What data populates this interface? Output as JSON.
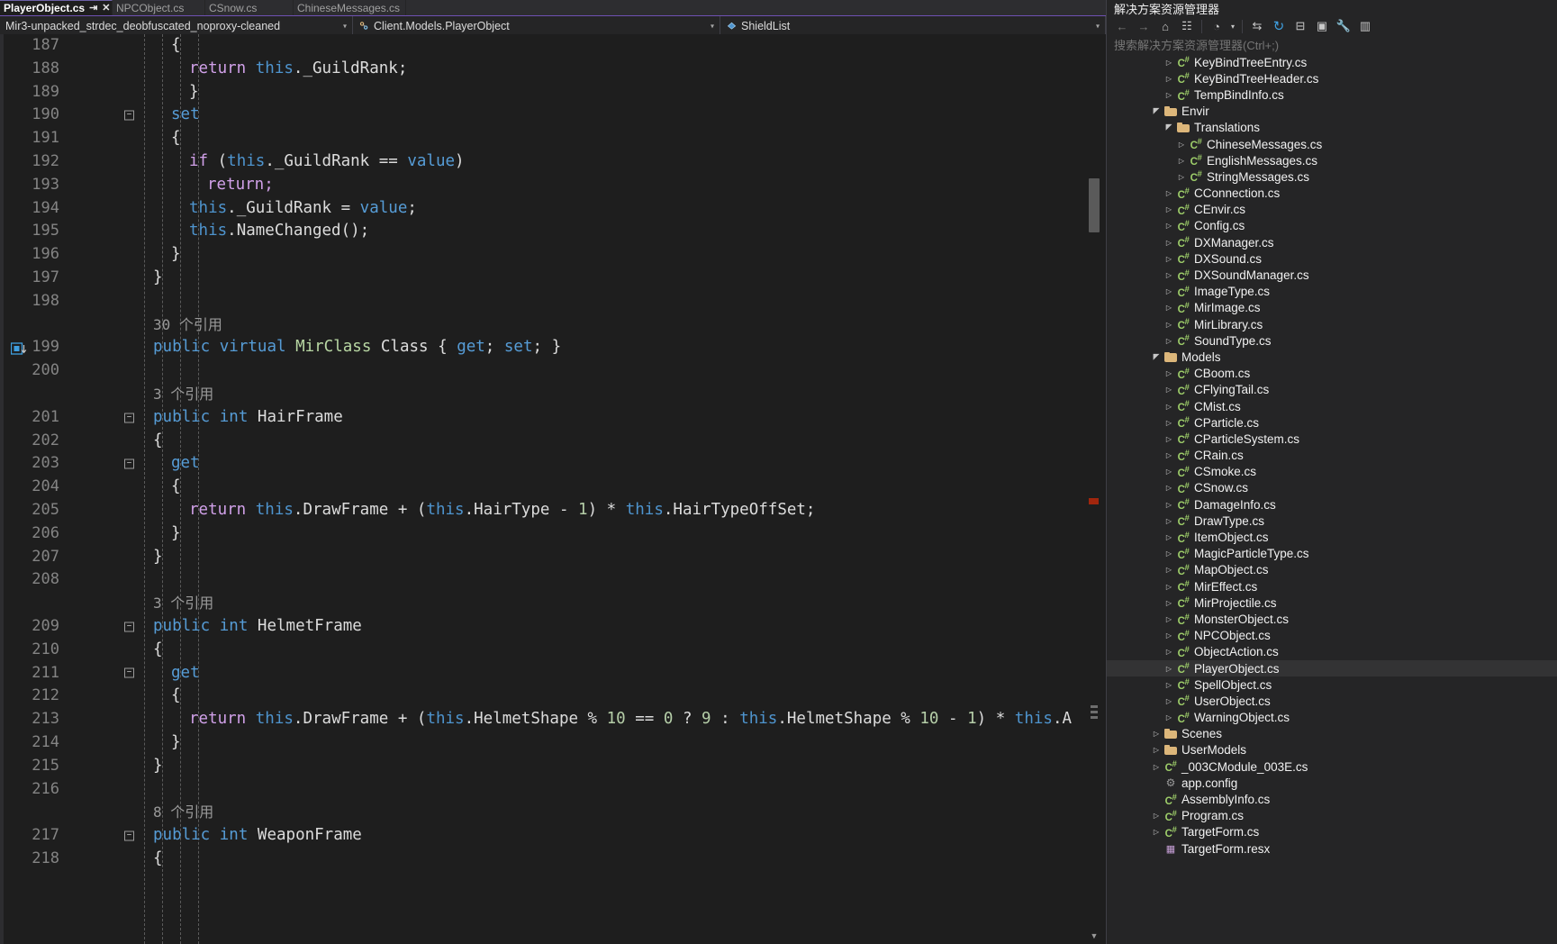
{
  "window": {
    "app": "Visual Studio",
    "theme_bg": "#1e1e1e",
    "accent": "#6f51b3"
  },
  "tabs": [
    {
      "label": "PlayerObject.cs",
      "active": true,
      "pin": "⇥",
      "close": "✕"
    },
    {
      "label": "NPCObject.cs",
      "active": false
    },
    {
      "label": "CSnow.cs",
      "active": false
    },
    {
      "label": "ChineseMessages.cs",
      "active": false
    }
  ],
  "navbar": {
    "project": "Mir3-unpacked_strdec_deobfuscated_noproxy-cleaned",
    "type": "Client.Models.PlayerObject",
    "member": "ShieldList",
    "caret": "▾"
  },
  "editor": {
    "first_line": 187,
    "lines": [
      {
        "num": "187",
        "indent": 4,
        "fold": false,
        "tokens": [
          {
            "t": "{",
            "c": "p"
          }
        ]
      },
      {
        "num": "188",
        "indent": 5,
        "fold": false,
        "tokens": [
          {
            "t": "return ",
            "c": "kc"
          },
          {
            "t": "this",
            "c": "th"
          },
          {
            "t": "._GuildRank;",
            "c": "p"
          }
        ]
      },
      {
        "num": "189",
        "indent": 5,
        "fold": false,
        "tokens": [
          {
            "t": "}",
            "c": "p"
          }
        ]
      },
      {
        "num": "190",
        "indent": 4,
        "fold": true,
        "tokens": [
          {
            "t": "set",
            "c": "k"
          }
        ]
      },
      {
        "num": "191",
        "indent": 4,
        "fold": false,
        "tokens": [
          {
            "t": "{",
            "c": "p"
          }
        ]
      },
      {
        "num": "192",
        "indent": 5,
        "fold": false,
        "tokens": [
          {
            "t": "if ",
            "c": "kc"
          },
          {
            "t": "(",
            "c": "p"
          },
          {
            "t": "this",
            "c": "th"
          },
          {
            "t": "._GuildRank == ",
            "c": "p"
          },
          {
            "t": "value",
            "c": "k"
          },
          {
            "t": ")",
            "c": "p"
          }
        ]
      },
      {
        "num": "193",
        "indent": 6,
        "fold": false,
        "tokens": [
          {
            "t": "return;",
            "c": "kc"
          }
        ]
      },
      {
        "num": "194",
        "indent": 5,
        "fold": false,
        "tokens": [
          {
            "t": "this",
            "c": "th"
          },
          {
            "t": "._GuildRank = ",
            "c": "p"
          },
          {
            "t": "value",
            "c": "k"
          },
          {
            "t": ";",
            "c": "p"
          }
        ]
      },
      {
        "num": "195",
        "indent": 5,
        "fold": false,
        "tokens": [
          {
            "t": "this",
            "c": "th"
          },
          {
            "t": ".NameChanged();",
            "c": "p"
          }
        ]
      },
      {
        "num": "196",
        "indent": 4,
        "fold": false,
        "tokens": [
          {
            "t": "}",
            "c": "p"
          }
        ]
      },
      {
        "num": "197",
        "indent": 3,
        "fold": false,
        "tokens": [
          {
            "t": "}",
            "c": "p"
          }
        ]
      },
      {
        "num": "198",
        "indent": 0,
        "fold": false,
        "tokens": []
      },
      {
        "num": "",
        "indent": 3,
        "fold": false,
        "codelens": "30 个引用"
      },
      {
        "num": "199",
        "indent": 3,
        "fold": false,
        "bookmark": true,
        "tokens": [
          {
            "t": "public ",
            "c": "k"
          },
          {
            "t": "virtual ",
            "c": "k"
          },
          {
            "t": "MirClass ",
            "c": "t"
          },
          {
            "t": "Class ",
            "c": "tw"
          },
          {
            "t": "{ ",
            "c": "p"
          },
          {
            "t": "get",
            "c": "k"
          },
          {
            "t": "; ",
            "c": "p"
          },
          {
            "t": "set",
            "c": "k"
          },
          {
            "t": "; ",
            "c": "p"
          },
          {
            "t": "}",
            "c": "p"
          }
        ]
      },
      {
        "num": "200",
        "indent": 0,
        "fold": false,
        "tokens": []
      },
      {
        "num": "",
        "indent": 3,
        "fold": false,
        "codelens": "3 个引用"
      },
      {
        "num": "201",
        "indent": 3,
        "fold": true,
        "tokens": [
          {
            "t": "public ",
            "c": "k"
          },
          {
            "t": "int ",
            "c": "k"
          },
          {
            "t": "HairFrame",
            "c": "tw"
          }
        ]
      },
      {
        "num": "202",
        "indent": 3,
        "fold": false,
        "tokens": [
          {
            "t": "{",
            "c": "p"
          }
        ]
      },
      {
        "num": "203",
        "indent": 4,
        "fold": true,
        "tokens": [
          {
            "t": "get",
            "c": "k"
          }
        ]
      },
      {
        "num": "204",
        "indent": 4,
        "fold": false,
        "tokens": [
          {
            "t": "{",
            "c": "p"
          }
        ]
      },
      {
        "num": "205",
        "indent": 5,
        "fold": false,
        "tokens": [
          {
            "t": "return ",
            "c": "kc"
          },
          {
            "t": "this",
            "c": "th"
          },
          {
            "t": ".DrawFrame + (",
            "c": "p"
          },
          {
            "t": "this",
            "c": "th"
          },
          {
            "t": ".HairType - ",
            "c": "p"
          },
          {
            "t": "1",
            "c": "n"
          },
          {
            "t": ") * ",
            "c": "p"
          },
          {
            "t": "this",
            "c": "th"
          },
          {
            "t": ".HairTypeOffSet;",
            "c": "p"
          }
        ]
      },
      {
        "num": "206",
        "indent": 4,
        "fold": false,
        "tokens": [
          {
            "t": "}",
            "c": "p"
          }
        ]
      },
      {
        "num": "207",
        "indent": 3,
        "fold": false,
        "tokens": [
          {
            "t": "}",
            "c": "p"
          }
        ]
      },
      {
        "num": "208",
        "indent": 0,
        "fold": false,
        "tokens": []
      },
      {
        "num": "",
        "indent": 3,
        "fold": false,
        "codelens": "3 个引用"
      },
      {
        "num": "209",
        "indent": 3,
        "fold": true,
        "tokens": [
          {
            "t": "public ",
            "c": "k"
          },
          {
            "t": "int ",
            "c": "k"
          },
          {
            "t": "HelmetFrame",
            "c": "tw"
          }
        ]
      },
      {
        "num": "210",
        "indent": 3,
        "fold": false,
        "tokens": [
          {
            "t": "{",
            "c": "p"
          }
        ]
      },
      {
        "num": "211",
        "indent": 4,
        "fold": true,
        "tokens": [
          {
            "t": "get",
            "c": "k"
          }
        ]
      },
      {
        "num": "212",
        "indent": 4,
        "fold": false,
        "tokens": [
          {
            "t": "{",
            "c": "p"
          }
        ]
      },
      {
        "num": "213",
        "indent": 5,
        "fold": false,
        "tokens": [
          {
            "t": "return ",
            "c": "kc"
          },
          {
            "t": "this",
            "c": "th"
          },
          {
            "t": ".DrawFrame + (",
            "c": "p"
          },
          {
            "t": "this",
            "c": "th"
          },
          {
            "t": ".HelmetShape % ",
            "c": "p"
          },
          {
            "t": "10",
            "c": "n"
          },
          {
            "t": " == ",
            "c": "p"
          },
          {
            "t": "0",
            "c": "n"
          },
          {
            "t": " ? ",
            "c": "p"
          },
          {
            "t": "9",
            "c": "n"
          },
          {
            "t": " : ",
            "c": "p"
          },
          {
            "t": "this",
            "c": "th"
          },
          {
            "t": ".HelmetShape % ",
            "c": "p"
          },
          {
            "t": "10",
            "c": "n"
          },
          {
            "t": " - ",
            "c": "p"
          },
          {
            "t": "1",
            "c": "n"
          },
          {
            "t": ") * ",
            "c": "p"
          },
          {
            "t": "this",
            "c": "th"
          },
          {
            "t": ".A",
            "c": "p"
          }
        ]
      },
      {
        "num": "214",
        "indent": 4,
        "fold": false,
        "tokens": [
          {
            "t": "}",
            "c": "p"
          }
        ]
      },
      {
        "num": "215",
        "indent": 3,
        "fold": false,
        "tokens": [
          {
            "t": "}",
            "c": "p"
          }
        ]
      },
      {
        "num": "216",
        "indent": 0,
        "fold": false,
        "tokens": []
      },
      {
        "num": "",
        "indent": 3,
        "fold": false,
        "codelens": "8 个引用"
      },
      {
        "num": "217",
        "indent": 3,
        "fold": true,
        "tokens": [
          {
            "t": "public ",
            "c": "k"
          },
          {
            "t": "int ",
            "c": "k"
          },
          {
            "t": "WeaponFrame",
            "c": "tw"
          }
        ]
      },
      {
        "num": "218",
        "indent": 3,
        "fold": false,
        "tokens": [
          {
            "t": "{",
            "c": "p"
          }
        ]
      }
    ],
    "scrollbar": {
      "up_arrow": "▲",
      "down_arrow": "▼"
    }
  },
  "solution_explorer": {
    "title": "解决方案资源管理器",
    "search_placeholder": "搜索解决方案资源管理器(Ctrl+;)",
    "toolbar": [
      {
        "name": "back-icon",
        "glyph": "←"
      },
      {
        "name": "forward-icon",
        "glyph": "→"
      },
      {
        "name": "home-icon",
        "glyph": "⌂"
      },
      {
        "name": "pending-changes-icon",
        "glyph": "☷"
      },
      {
        "name": "history-icon",
        "glyph": "◔"
      },
      {
        "name": "history-dropdown-icon",
        "glyph": "▾"
      },
      {
        "name": "sync-with-active-document-icon",
        "glyph": "⇆"
      },
      {
        "name": "refresh-icon",
        "glyph": "↻"
      },
      {
        "name": "collapse-all-icon",
        "glyph": "⊟"
      },
      {
        "name": "show-all-files-icon",
        "glyph": "▣"
      },
      {
        "name": "properties-icon",
        "glyph": "🔧"
      },
      {
        "name": "preview-selected-items-icon",
        "glyph": "▥"
      }
    ],
    "tree": [
      {
        "label": "KeyBindTreeEntry.cs",
        "depth": 4,
        "icon": "cs",
        "expander": "collapsed"
      },
      {
        "label": "KeyBindTreeHeader.cs",
        "depth": 4,
        "icon": "cs",
        "expander": "collapsed"
      },
      {
        "label": "TempBindInfo.cs",
        "depth": 4,
        "icon": "cs",
        "expander": "collapsed"
      },
      {
        "label": "Envir",
        "depth": 3,
        "icon": "folder",
        "expander": "expanded"
      },
      {
        "label": "Translations",
        "depth": 4,
        "icon": "folder",
        "expander": "expanded"
      },
      {
        "label": "ChineseMessages.cs",
        "depth": 5,
        "icon": "cs",
        "expander": "collapsed"
      },
      {
        "label": "EnglishMessages.cs",
        "depth": 5,
        "icon": "cs",
        "expander": "collapsed"
      },
      {
        "label": "StringMessages.cs",
        "depth": 5,
        "icon": "cs",
        "expander": "collapsed"
      },
      {
        "label": "CConnection.cs",
        "depth": 4,
        "icon": "cs",
        "expander": "collapsed"
      },
      {
        "label": "CEnvir.cs",
        "depth": 4,
        "icon": "cs",
        "expander": "collapsed"
      },
      {
        "label": "Config.cs",
        "depth": 4,
        "icon": "cs",
        "expander": "collapsed"
      },
      {
        "label": "DXManager.cs",
        "depth": 4,
        "icon": "cs",
        "expander": "collapsed"
      },
      {
        "label": "DXSound.cs",
        "depth": 4,
        "icon": "cs",
        "expander": "collapsed"
      },
      {
        "label": "DXSoundManager.cs",
        "depth": 4,
        "icon": "cs",
        "expander": "collapsed"
      },
      {
        "label": "ImageType.cs",
        "depth": 4,
        "icon": "cs",
        "expander": "collapsed"
      },
      {
        "label": "MirImage.cs",
        "depth": 4,
        "icon": "cs",
        "expander": "collapsed"
      },
      {
        "label": "MirLibrary.cs",
        "depth": 4,
        "icon": "cs",
        "expander": "collapsed"
      },
      {
        "label": "SoundType.cs",
        "depth": 4,
        "icon": "cs",
        "expander": "collapsed"
      },
      {
        "label": "Models",
        "depth": 3,
        "icon": "folder",
        "expander": "expanded"
      },
      {
        "label": "CBoom.cs",
        "depth": 4,
        "icon": "cs",
        "expander": "collapsed"
      },
      {
        "label": "CFlyingTail.cs",
        "depth": 4,
        "icon": "cs",
        "expander": "collapsed"
      },
      {
        "label": "CMist.cs",
        "depth": 4,
        "icon": "cs",
        "expander": "collapsed"
      },
      {
        "label": "CParticle.cs",
        "depth": 4,
        "icon": "cs",
        "expander": "collapsed"
      },
      {
        "label": "CParticleSystem.cs",
        "depth": 4,
        "icon": "cs",
        "expander": "collapsed"
      },
      {
        "label": "CRain.cs",
        "depth": 4,
        "icon": "cs",
        "expander": "collapsed"
      },
      {
        "label": "CSmoke.cs",
        "depth": 4,
        "icon": "cs",
        "expander": "collapsed"
      },
      {
        "label": "CSnow.cs",
        "depth": 4,
        "icon": "cs",
        "expander": "collapsed"
      },
      {
        "label": "DamageInfo.cs",
        "depth": 4,
        "icon": "cs",
        "expander": "collapsed"
      },
      {
        "label": "DrawType.cs",
        "depth": 4,
        "icon": "cs",
        "expander": "collapsed"
      },
      {
        "label": "ItemObject.cs",
        "depth": 4,
        "icon": "cs",
        "expander": "collapsed"
      },
      {
        "label": "MagicParticleType.cs",
        "depth": 4,
        "icon": "cs",
        "expander": "collapsed"
      },
      {
        "label": "MapObject.cs",
        "depth": 4,
        "icon": "cs",
        "expander": "collapsed"
      },
      {
        "label": "MirEffect.cs",
        "depth": 4,
        "icon": "cs",
        "expander": "collapsed"
      },
      {
        "label": "MirProjectile.cs",
        "depth": 4,
        "icon": "cs",
        "expander": "collapsed"
      },
      {
        "label": "MonsterObject.cs",
        "depth": 4,
        "icon": "cs",
        "expander": "collapsed"
      },
      {
        "label": "NPCObject.cs",
        "depth": 4,
        "icon": "cs",
        "expander": "collapsed"
      },
      {
        "label": "ObjectAction.cs",
        "depth": 4,
        "icon": "cs",
        "expander": "collapsed"
      },
      {
        "label": "PlayerObject.cs",
        "depth": 4,
        "icon": "cs",
        "expander": "collapsed",
        "selected": true
      },
      {
        "label": "SpellObject.cs",
        "depth": 4,
        "icon": "cs",
        "expander": "collapsed"
      },
      {
        "label": "UserObject.cs",
        "depth": 4,
        "icon": "cs",
        "expander": "collapsed"
      },
      {
        "label": "WarningObject.cs",
        "depth": 4,
        "icon": "cs",
        "expander": "collapsed"
      },
      {
        "label": "Scenes",
        "depth": 3,
        "icon": "folder",
        "expander": "collapsed"
      },
      {
        "label": "UserModels",
        "depth": 3,
        "icon": "folder",
        "expander": "collapsed"
      },
      {
        "label": "_003CModule_003E.cs",
        "depth": 3,
        "icon": "cs",
        "expander": "collapsed"
      },
      {
        "label": "app.config",
        "depth": 3,
        "icon": "config",
        "expander": "none"
      },
      {
        "label": "AssemblyInfo.cs",
        "depth": 3,
        "icon": "cs",
        "expander": "none"
      },
      {
        "label": "Program.cs",
        "depth": 3,
        "icon": "cs",
        "expander": "collapsed"
      },
      {
        "label": "TargetForm.cs",
        "depth": 3,
        "icon": "cs",
        "expander": "collapsed"
      },
      {
        "label": "TargetForm.resx",
        "depth": 3,
        "icon": "resx",
        "expander": "none"
      }
    ]
  }
}
